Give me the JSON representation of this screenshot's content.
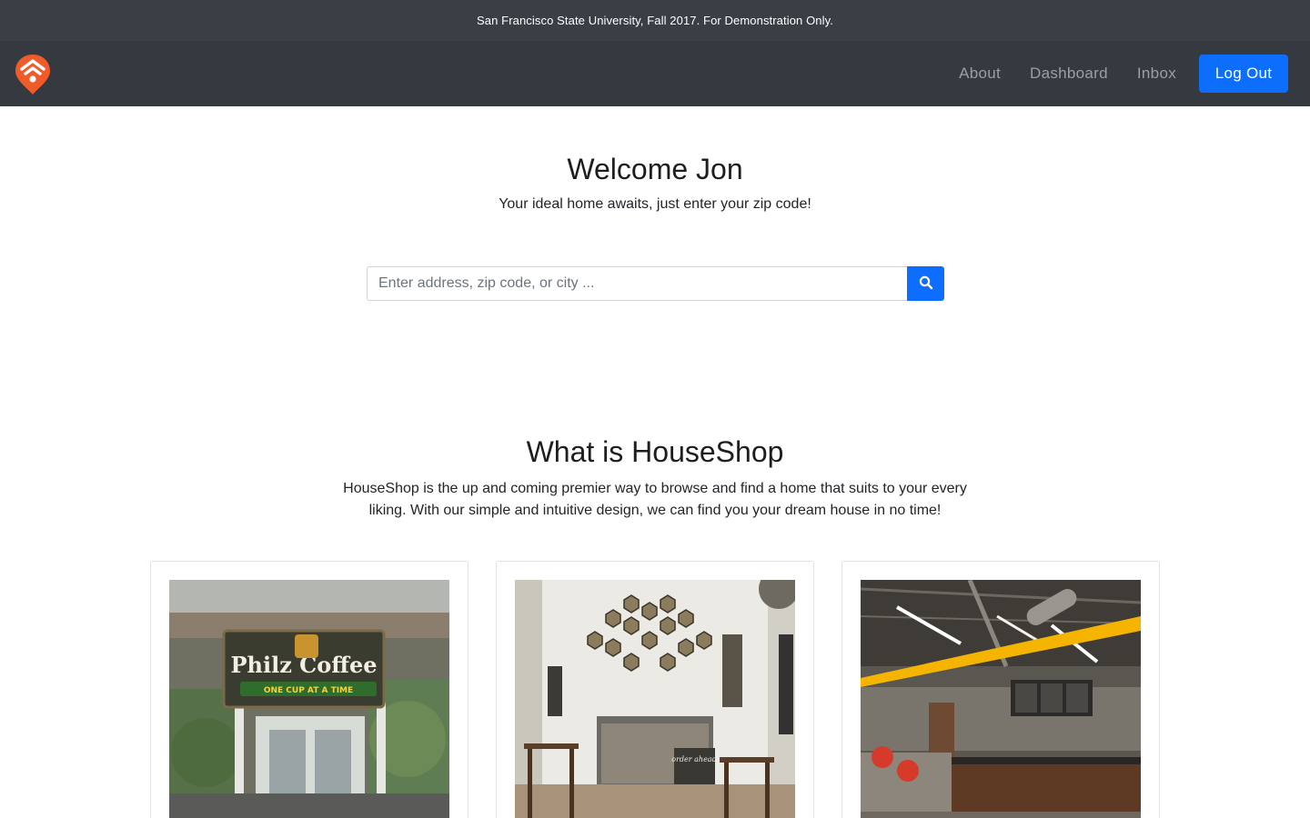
{
  "banner": {
    "text": "San Francisco State University, Fall 2017. For Demonstration Only."
  },
  "nav": {
    "logo": "houseshop-logo-icon",
    "links": [
      "About",
      "Dashboard",
      "Inbox"
    ],
    "logout_label": "Log Out"
  },
  "hero": {
    "title": "Welcome Jon",
    "subtitle": "Your ideal home awaits, just enter your zip code!"
  },
  "search": {
    "placeholder": "Enter address, zip code, or city ...",
    "value": "",
    "button_icon": "search-icon"
  },
  "about": {
    "title": "What is HouseShop",
    "text": "HouseShop is the up and coming premier way to browse and find a home that suits to your every liking. With our simple and intuitive design, we can find you your dream house in no time!"
  },
  "cards": [
    {
      "image": "philz-coffee-storefront-photo",
      "sign_main": "Philz Coffee",
      "sign_tagline": "ONE CUP AT A TIME"
    },
    {
      "image": "cafe-interior-photo",
      "board_text": "order ahead"
    },
    {
      "image": "modern-coffee-shop-interior-photo"
    }
  ],
  "colors": {
    "banner_bg": "#3a3f46",
    "navbar_bg": "#343a40",
    "accent": "#0d6efd",
    "logo": "#f15a29"
  }
}
